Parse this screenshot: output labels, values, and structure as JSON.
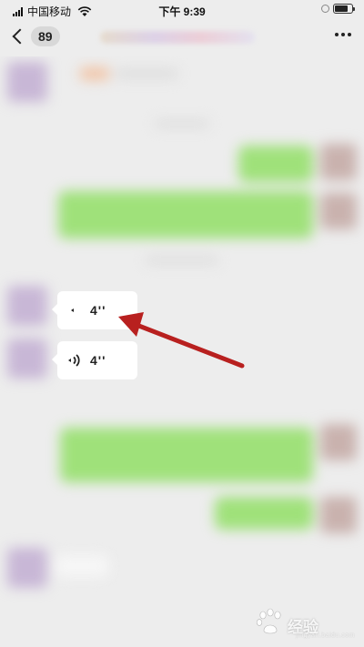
{
  "status_bar": {
    "carrier": "中国移动",
    "time": "下午 9:39"
  },
  "nav": {
    "unread_count": "89"
  },
  "messages": [
    {
      "type": "voice",
      "duration": "4''",
      "state": "playing"
    },
    {
      "type": "voice",
      "duration": "4''",
      "state": "idle"
    }
  ],
  "annotation": {
    "arrow_color": "#b8201f"
  },
  "watermark": {
    "text": "经验",
    "sub": "jingyan.baidu.com"
  },
  "colors": {
    "chat_background": "#ededed",
    "sent_bubble": "#9fe17a",
    "received_bubble": "#ffffff"
  }
}
